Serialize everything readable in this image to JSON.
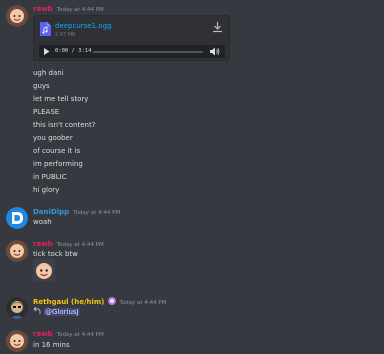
{
  "messages": [
    {
      "username": "rawb",
      "username_color": "#e91e63",
      "timestamp": "Today at 4:44 PM",
      "attachment": {
        "filename": "deepcurse1.ogg",
        "size": "2.47 MB",
        "time": "0:00 / 3:14"
      },
      "lines": [
        "ugh dani",
        "guys",
        "let me tell story",
        "PLEASE",
        "this isn't content?",
        "you goober",
        "of course it is",
        "im performing",
        "in PUBLIC",
        "hi glory"
      ]
    },
    {
      "username": "DaniDipp",
      "username_color": "#3498db",
      "timestamp": "Today at 4:44 PM",
      "lines": [
        "woah"
      ]
    },
    {
      "username": "rawb",
      "username_color": "#e91e63",
      "timestamp": "Today at 4:44 PM",
      "lines": [
        "tick tock btw"
      ]
    },
    {
      "username": "Rethgaul (he/him)",
      "username_color": "#f1c40f",
      "timestamp": "Today at 4:44 PM",
      "reply_mention": "@GloriusJ"
    },
    {
      "username": "rawb",
      "username_color": "#e91e63",
      "timestamp": "Today at 4:44 PM",
      "lines": [
        "in 16 mins"
      ]
    }
  ]
}
